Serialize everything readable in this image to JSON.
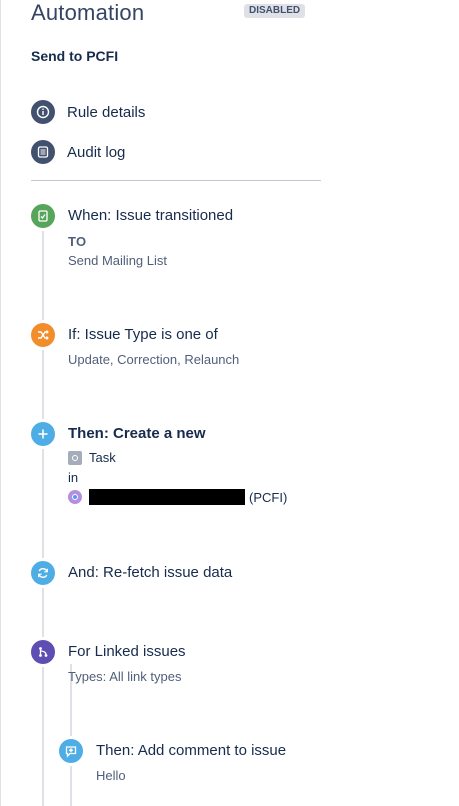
{
  "header": {
    "title": "Automation",
    "status_badge": "DISABLED"
  },
  "rule": {
    "name": "Send to PCFI"
  },
  "menu": [
    {
      "label": "Rule details",
      "icon": "info-icon"
    },
    {
      "label": "Audit log",
      "icon": "list-icon"
    }
  ],
  "steps": {
    "trigger": {
      "heading": "When: Issue transitioned",
      "to_label": "TO",
      "to_value": "Send Mailing List",
      "color": "#57a55a"
    },
    "condition": {
      "heading": "If: Issue Type is one of",
      "value": "Update, Correction, Relaunch",
      "color": "#f18d2b"
    },
    "create": {
      "heading": "Then: Create a new",
      "issue_type": "Task",
      "in_label": "in",
      "project_key": "(PCFI)",
      "color": "#4fade6"
    },
    "refetch": {
      "heading": "And: Re-fetch issue data",
      "color": "#4fade6"
    },
    "branch": {
      "heading": "For Linked issues",
      "types": "Types: All link types",
      "color": "#5e4db2"
    },
    "comment": {
      "heading": "Then: Add comment to issue",
      "value": "Hello",
      "color": "#4fade6"
    }
  },
  "colors": {
    "menu_circle": "#42526e",
    "divider": "#c1c7d0",
    "timeline": "#dfe1e6"
  }
}
